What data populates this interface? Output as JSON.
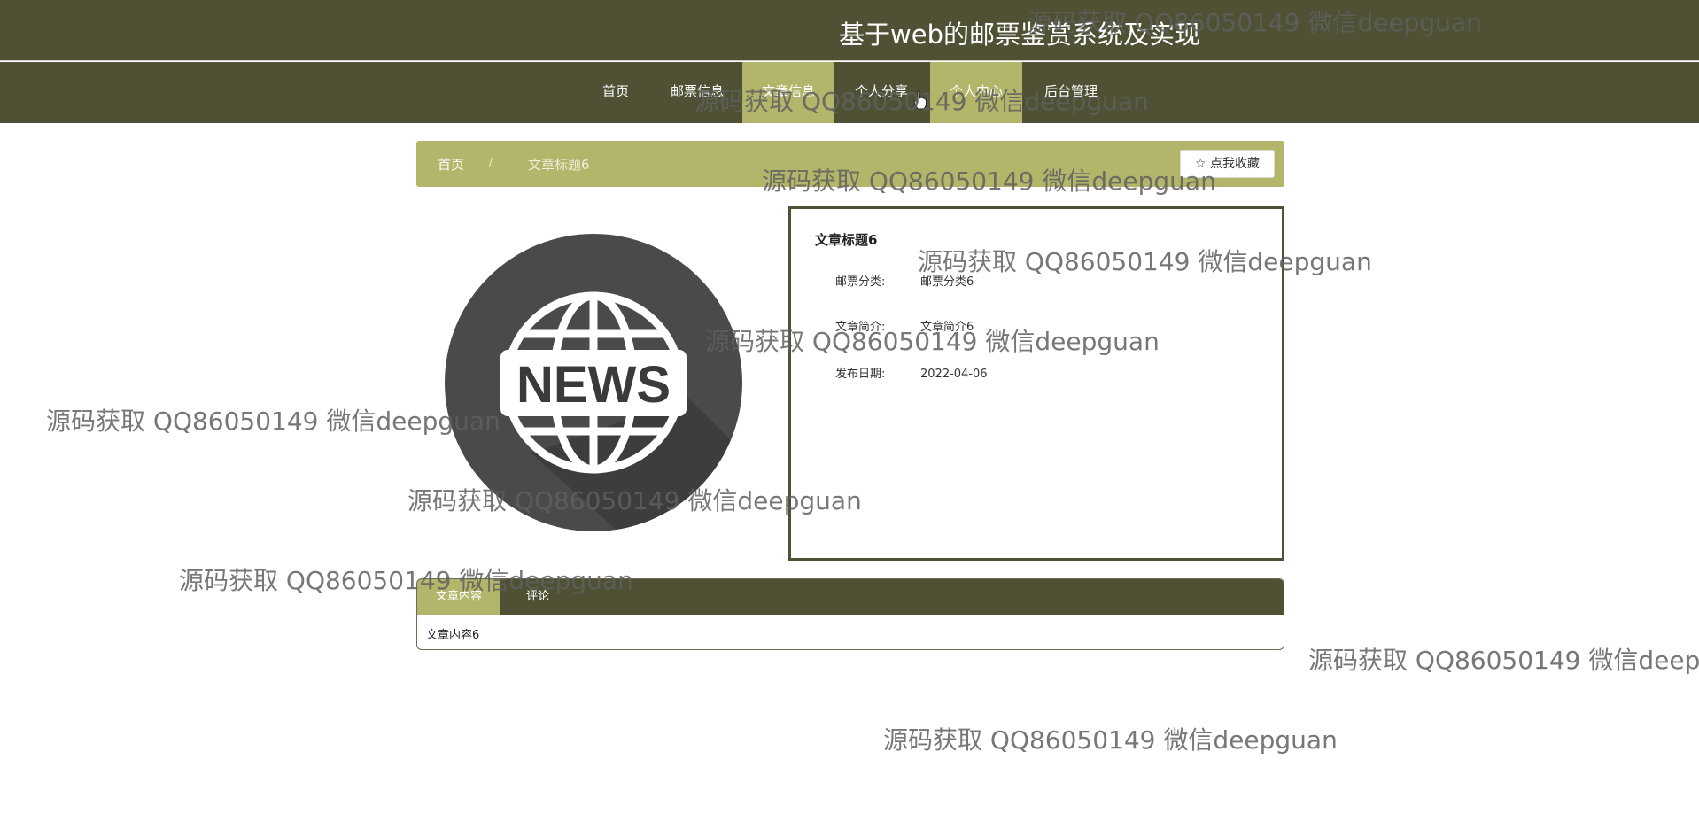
{
  "header": {
    "site_title": "基于web的邮票鉴赏系统及实现"
  },
  "nav": {
    "items": [
      {
        "label": "首页",
        "active": false
      },
      {
        "label": "邮票信息",
        "active": false
      },
      {
        "label": "文章信息",
        "active": true
      },
      {
        "label": "个人分享",
        "active": false
      },
      {
        "label": "个人中心",
        "active": true
      },
      {
        "label": "后台管理",
        "active": false
      }
    ]
  },
  "breadcrumb": {
    "home": "首页",
    "separator": "/",
    "current": "文章标题6",
    "favorite_button": "☆ 点我收藏"
  },
  "image": {
    "icon": "news-globe-icon",
    "text": "NEWS"
  },
  "detail": {
    "title": "文章标题6",
    "fields": [
      {
        "label": "邮票分类:",
        "value": "邮票分类6"
      },
      {
        "label": "文章简介:",
        "value": "文章简介6"
      },
      {
        "label": "发布日期:",
        "value": "2022-04-06"
      }
    ]
  },
  "tabs": {
    "items": [
      {
        "label": "文章内容",
        "active": true
      },
      {
        "label": "评论",
        "active": false
      }
    ],
    "content": "文章内容6"
  },
  "watermark": {
    "text": "源码获取 QQ86050149 微信deepguan"
  },
  "colors": {
    "primary": "#4f5034",
    "accent": "#b3b66a"
  }
}
